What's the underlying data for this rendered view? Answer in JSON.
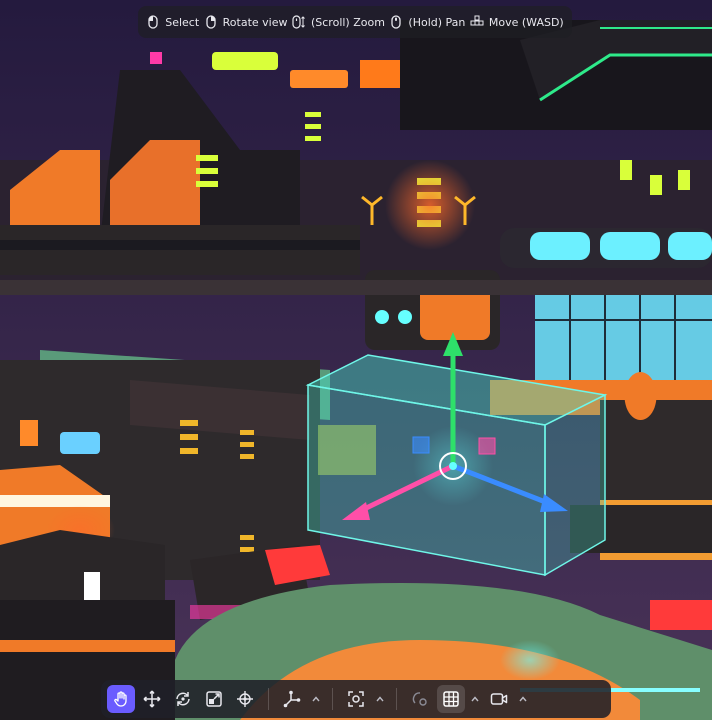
{
  "hints": [
    {
      "icon": "mouse-left-icon",
      "label": "Select"
    },
    {
      "icon": "mouse-right-icon",
      "label": "Rotate view"
    },
    {
      "icon": "mouse-scroll-icon",
      "label": "(Scroll) Zoom"
    },
    {
      "icon": "mouse-middle-icon",
      "label": "(Hold) Pan"
    },
    {
      "icon": "wasd-keys-icon",
      "label": "Move (WASD)"
    }
  ],
  "toolbar": {
    "tools": [
      "hand-tool",
      "move-tool",
      "rotate-tool",
      "scale-tool",
      "transform-tool",
      "pivot-tool",
      "snap-tool",
      "orbit-camera-tool",
      "grid-toggle",
      "camera-view"
    ],
    "active_tool": "hand-tool"
  },
  "colors": {
    "accent": "#6a5cff",
    "gizmo_y": "#2ee06a",
    "gizmo_x": "#ff4fa8",
    "gizmo_z": "#3a8cff",
    "selection": "#46e0c8"
  }
}
